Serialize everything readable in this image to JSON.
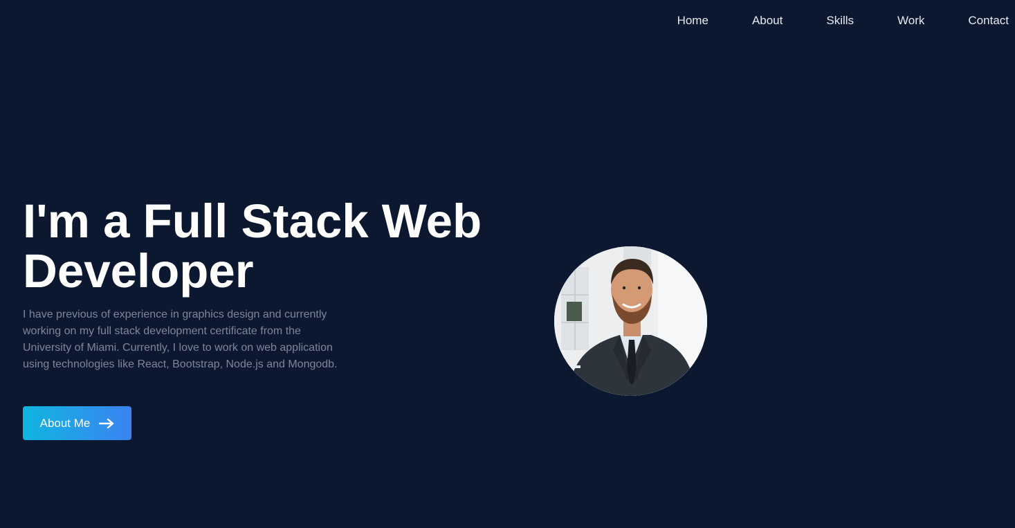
{
  "nav": {
    "items": [
      {
        "label": "Home"
      },
      {
        "label": "About"
      },
      {
        "label": "Skills"
      },
      {
        "label": "Work"
      },
      {
        "label": "Contact"
      }
    ]
  },
  "hero": {
    "title": "I'm a Full Stack Web Developer",
    "description": "I have previous of experience in graphics design and currently working on my full stack development certificate from the University of Miami. Currently, I love to work on web application using technologies like React, Bootstrap, Node.js and Mongodb.",
    "cta_label": "About Me",
    "cta_icon": "arrow-right-icon",
    "avatar_icon": "profile-photo"
  },
  "colors": {
    "background": "#0b1830",
    "text_primary": "#ffffff",
    "text_muted": "#7d8698",
    "button_gradient_start": "#10b5e0",
    "button_gradient_end": "#3b83f2"
  }
}
